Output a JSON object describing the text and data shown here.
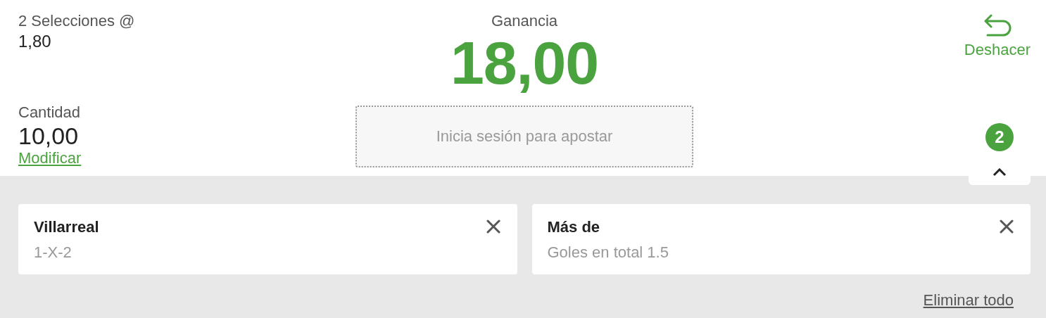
{
  "summary": {
    "selections": "2 Selecciones @",
    "odds": "1,80",
    "stake_label": "Cantidad",
    "stake": "10,00",
    "modify_link": "Modificar"
  },
  "winnings": {
    "label": "Ganancia",
    "amount": "18,00"
  },
  "login_button": {
    "label": "Inicia sesión para apostar",
    "disabled": true
  },
  "undo": {
    "label": "Deshacer"
  },
  "slip_toggle": {
    "count": "2",
    "expanded": false
  },
  "selections": [
    {
      "title": "Villarreal",
      "market": "1-X-2"
    },
    {
      "title": "Más de",
      "market": "Goles en total 1.5"
    }
  ],
  "remove_all": "Eliminar todo"
}
